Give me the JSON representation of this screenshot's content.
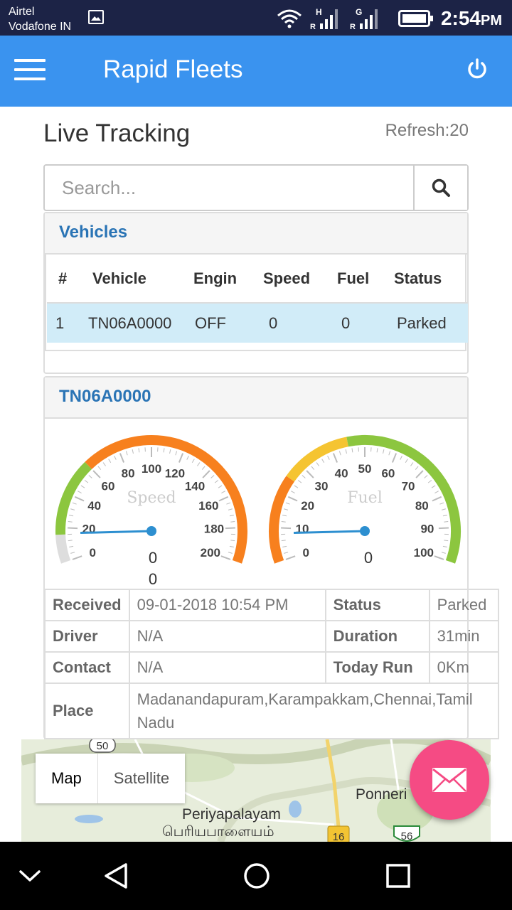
{
  "status_bar": {
    "carrier_1": "Airtel",
    "carrier_2": "Vodafone IN",
    "network_1": "H",
    "network_2": "G",
    "roaming": "R",
    "time": "2:54",
    "ampm": "PM",
    "icons": [
      "image-icon",
      "wifi-icon",
      "signal-icon",
      "signal-icon",
      "battery-icon"
    ]
  },
  "app_bar": {
    "title": "Rapid Fleets",
    "menu_icon": "hamburger-icon",
    "power_icon": "power-icon",
    "color": "#3a93ef"
  },
  "page": {
    "title": "Live Tracking",
    "refresh": "Refresh:20"
  },
  "search": {
    "placeholder": "Search...",
    "icon": "search-icon"
  },
  "vehicles_panel": {
    "title": "Vehicles",
    "columns": [
      "#",
      "Vehicle",
      "Engin",
      "Speed",
      "Fuel",
      "Status"
    ],
    "rows": [
      {
        "num": "1",
        "vehicle": "TN06A0000",
        "engine": "OFF",
        "speed": "0",
        "fuel": "0",
        "status": "Parked"
      }
    ]
  },
  "detail_panel": {
    "title": "TN06A0000",
    "speed_gauge": {
      "label": "Speed",
      "ticks": [
        "0",
        "20",
        "40",
        "60",
        "80",
        "100",
        "120",
        "140",
        "160",
        "180",
        "200"
      ],
      "value": 0,
      "value_text": "0",
      "extra_text": "0",
      "max": 200
    },
    "fuel_gauge": {
      "label": "Fuel",
      "ticks": [
        "0",
        "10",
        "20",
        "30",
        "40",
        "50",
        "60",
        "70",
        "80",
        "90",
        "100"
      ],
      "value": 0,
      "value_text": "0",
      "max": 100
    },
    "info": {
      "received_label": "Received",
      "received_value": "09-01-2018 10:54 PM",
      "status_label": "Status",
      "status_value": "Parked",
      "driver_label": "Driver",
      "driver_value": "N/A",
      "duration_label": "Duration",
      "duration_value": "31min",
      "contact_label": "Contact",
      "contact_value": "N/A",
      "today_run_label": "Today Run",
      "today_run_value": "0Km",
      "place_label": "Place",
      "place_value": "Madanandapuram,Karampakkam,Chennai,Tamil Nadu"
    }
  },
  "map": {
    "tab_map": "Map",
    "tab_satellite": "Satellite",
    "labels": [
      "Periyapalayam",
      "பெரியபாளையம்",
      "Ponneri"
    ],
    "shields": [
      "50",
      "16",
      "56"
    ]
  },
  "fab": {
    "icon": "mail-icon",
    "color": "#f54b84"
  },
  "nav_bar": {
    "icons": [
      "chevron-down-icon",
      "back-icon",
      "home-icon",
      "recents-icon"
    ]
  }
}
